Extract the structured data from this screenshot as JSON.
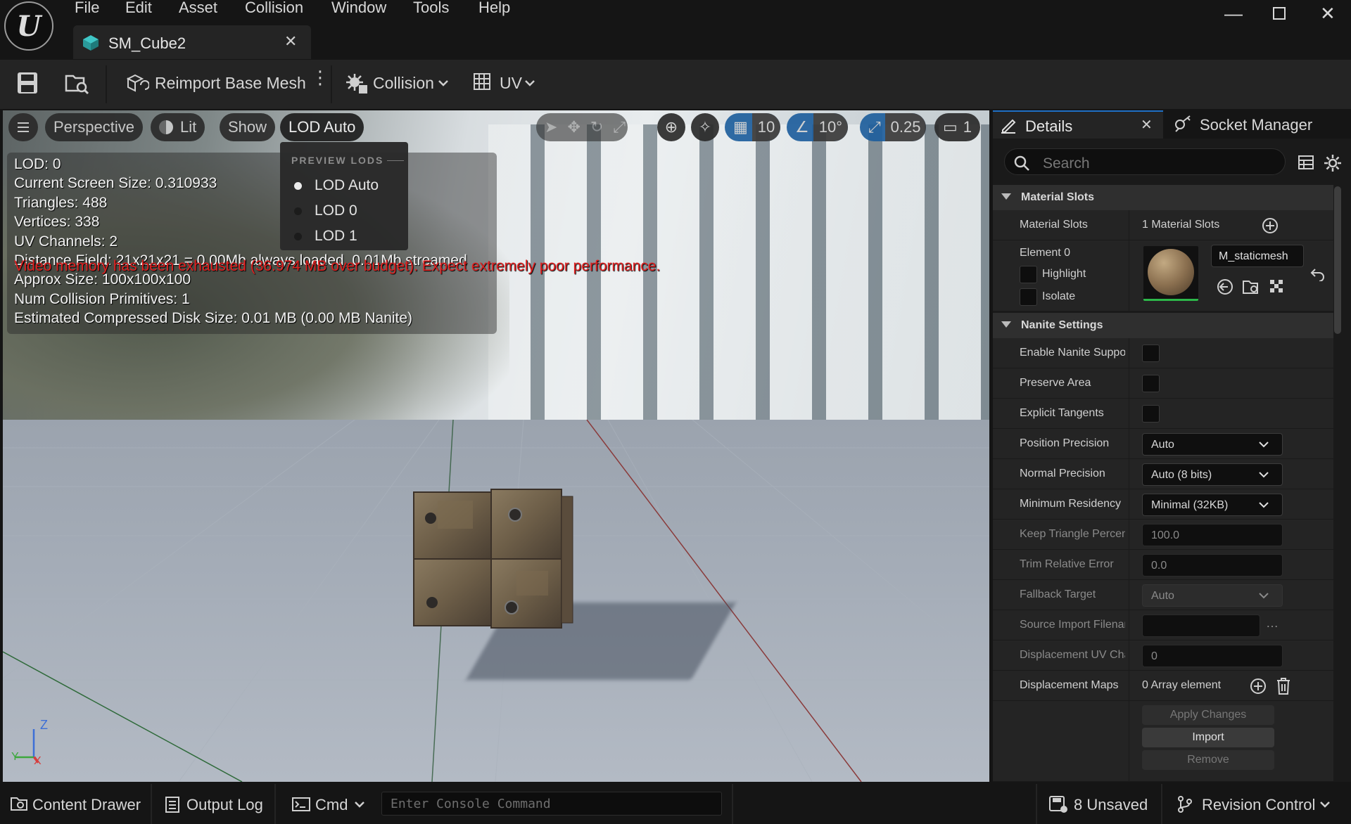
{
  "app": {
    "menu": [
      "File",
      "Edit",
      "Asset",
      "Collision",
      "Window",
      "Tools",
      "Help"
    ],
    "document_tab": "SM_Cube2"
  },
  "toolbar": {
    "reimport_label": "Reimport Base Mesh",
    "collision_label": "Collision",
    "uv_label": "UV"
  },
  "viewport": {
    "perspective_label": "Perspective",
    "lit_label": "Lit",
    "show_label": "Show",
    "lod_label": "LOD Auto",
    "grid_snap": "10",
    "rotation_snap": "10°",
    "scale_snap": "0.25",
    "camera_speed": "1",
    "stats": [
      "LOD:  0",
      "Current Screen Size:  0.310933",
      "Triangles:  488",
      "Vertices:  338",
      "UV Channels:  2",
      "Distance Field:  21x21x21 = 0.00Mb always loaded, 0.01Mb streamed",
      "Approx Size: 100x100x100",
      "Num Collision Primitives:  1",
      "Estimated Compressed Disk Size: 0.01 MB (0.00 MB Nanite)"
    ],
    "warning": "Video memory has been exhausted (36.974 MB over budget). Expect extremely poor performance.",
    "lod_menu": {
      "header": "PREVIEW LODS",
      "options": [
        "LOD Auto",
        "LOD 0",
        "LOD 1"
      ],
      "selected": "LOD Auto"
    },
    "axis": {
      "z": "Z",
      "y": "Y",
      "x": "X"
    }
  },
  "panel": {
    "tab_details": "Details",
    "tab_socket": "Socket Manager",
    "search_placeholder": "Search",
    "material_section": "Material Slots",
    "material_slots_label": "Material Slots",
    "material_slots_value": "1 Material Slots",
    "element_label": "Element 0",
    "highlight_label": "Highlight",
    "isolate_label": "Isolate",
    "material_name": "M_staticmesh",
    "nanite_section": "Nanite Settings",
    "rows": {
      "enable_nanite": "Enable Nanite Support",
      "preserve_area": "Preserve Area",
      "explicit_tangents": "Explicit Tangents",
      "position_precision": "Position Precision",
      "position_precision_value": "Auto",
      "normal_precision": "Normal Precision",
      "normal_precision_value": "Auto (8 bits)",
      "min_residency": "Minimum Residency",
      "min_residency_value": "Minimal (32KB)",
      "keep_triangle": "Keep Triangle Percent",
      "keep_triangle_value": "100.0",
      "trim_error": "Trim Relative Error",
      "trim_error_value": "0.0",
      "fallback_target": "Fallback Target",
      "fallback_target_value": "Auto",
      "source_import": "Source Import Filename",
      "source_import_value": "",
      "displacement_uv": "Displacement UV Channel",
      "displacement_uv_value": "0",
      "displacement_maps": "Displacement Maps",
      "displacement_maps_value": "0 Array element"
    },
    "apply_label": "Apply Changes",
    "import_label": "Import",
    "remove_label": "Remove"
  },
  "statusbar": {
    "content_drawer": "Content Drawer",
    "output_log": "Output Log",
    "cmd": "Cmd",
    "console_placeholder": "Enter Console Command",
    "unsaved": "8 Unsaved",
    "revision_control": "Revision Control"
  }
}
